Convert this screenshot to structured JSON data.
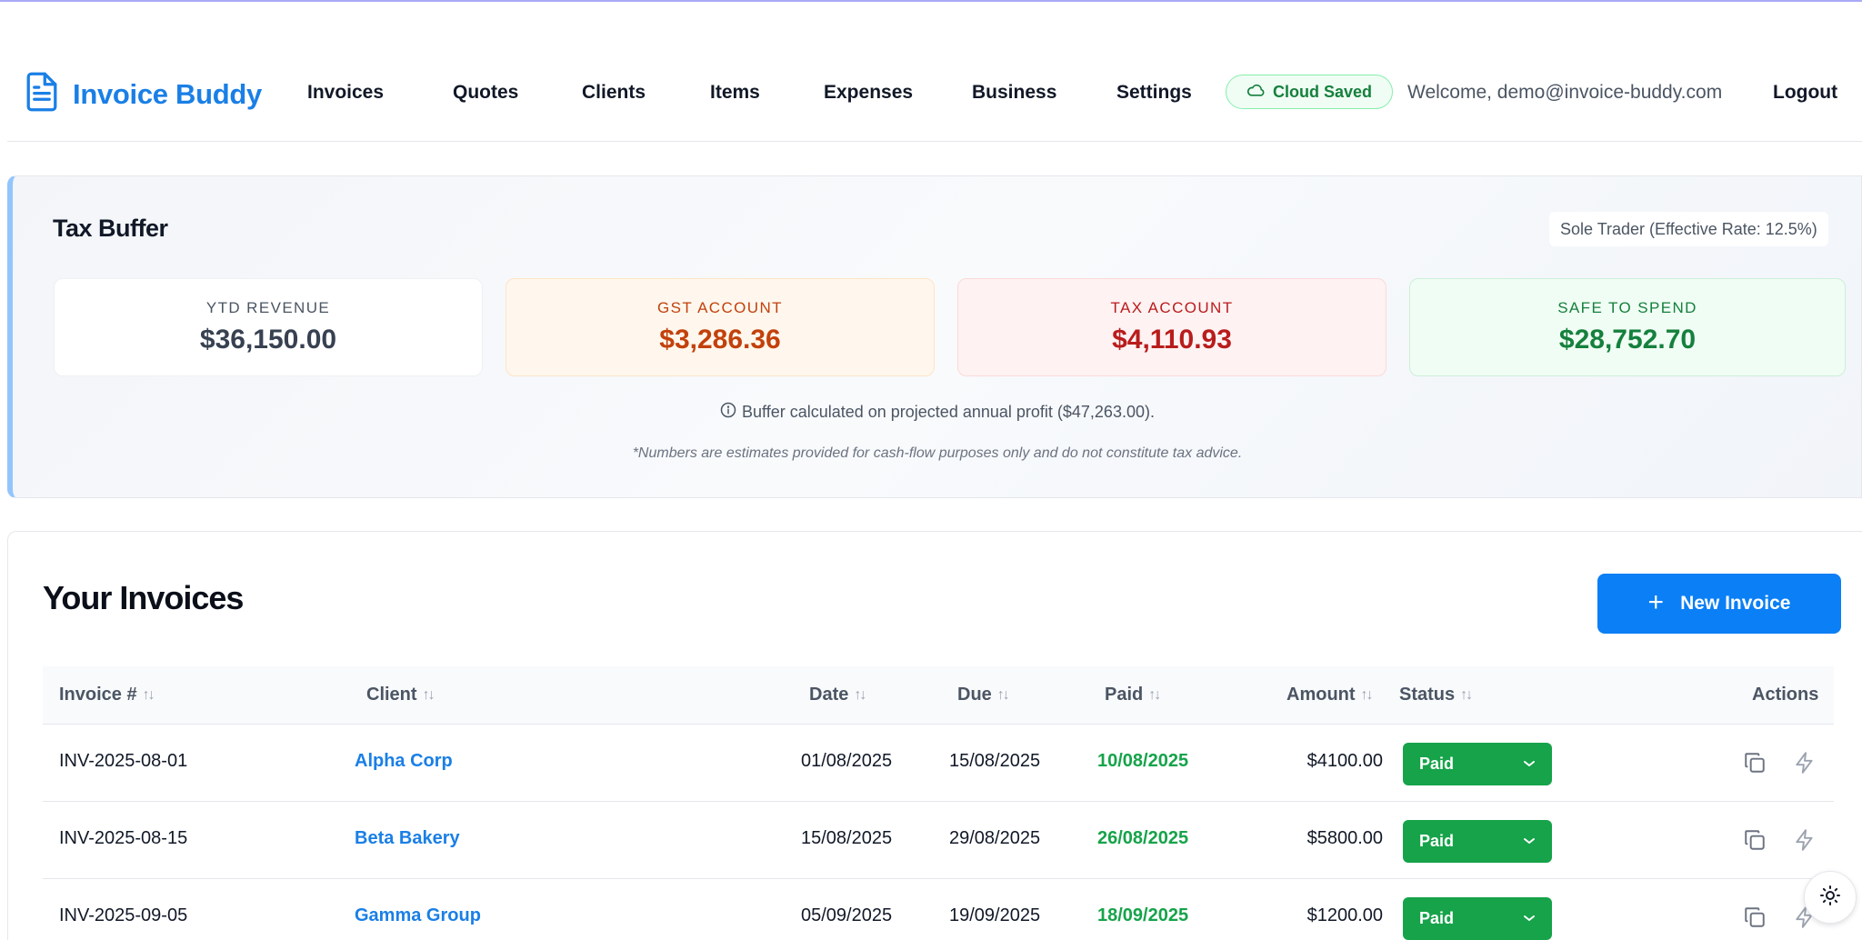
{
  "app": {
    "name": "Invoice Buddy"
  },
  "nav": {
    "items": [
      "Invoices",
      "Quotes",
      "Clients",
      "Items",
      "Expenses",
      "Business",
      "Settings"
    ]
  },
  "header": {
    "cloud_status": "Cloud Saved",
    "welcome": "Welcome, demo@invoice-buddy.com",
    "logout": "Logout"
  },
  "tax": {
    "title": "Tax Buffer",
    "entity": "Sole Trader (Effective Rate: 12.5%)",
    "stats": [
      {
        "label": "YTD Revenue",
        "value": "$36,150.00"
      },
      {
        "label": "GST Account",
        "value": "$3,286.36"
      },
      {
        "label": "Tax Account",
        "value": "$4,110.93"
      },
      {
        "label": "Safe to Spend",
        "value": "$28,752.70"
      }
    ],
    "note": "Buffer calculated on projected annual profit ($47,263.00).",
    "disclaimer": "*Numbers are estimates provided for cash-flow purposes only and do not constitute tax advice."
  },
  "invoices": {
    "title": "Your Invoices",
    "new_button": "New Invoice",
    "columns": [
      "Invoice #",
      "Client",
      "Date",
      "Due",
      "Paid",
      "Amount",
      "Status",
      "Actions"
    ],
    "rows": [
      {
        "number": "INV-2025-08-01",
        "client": "Alpha Corp",
        "date": "01/08/2025",
        "due": "15/08/2025",
        "paid": "10/08/2025",
        "amount": "$4100.00",
        "status": "Paid"
      },
      {
        "number": "INV-2025-08-15",
        "client": "Beta Bakery",
        "date": "15/08/2025",
        "due": "29/08/2025",
        "paid": "26/08/2025",
        "amount": "$5800.00",
        "status": "Paid"
      },
      {
        "number": "INV-2025-09-05",
        "client": "Gamma Group",
        "date": "05/09/2025",
        "due": "19/09/2025",
        "paid": "18/09/2025",
        "amount": "$1200.00",
        "status": "Paid"
      }
    ]
  },
  "icons": {
    "logo": "document-icon",
    "cloud": "cloud-icon",
    "info": "info-icon",
    "sort": "sort-icon",
    "copy": "copy-icon",
    "bolt": "lightning-icon",
    "theme": "sun-icon",
    "dropdown": "chevron-down-icon"
  },
  "colors": {
    "brand": "#1a7fe6",
    "primary_button": "#0b7ff5",
    "paid_green": "#16a34a",
    "gst": "#c2410c",
    "tax": "#b91c1c",
    "safe": "#15803d"
  }
}
